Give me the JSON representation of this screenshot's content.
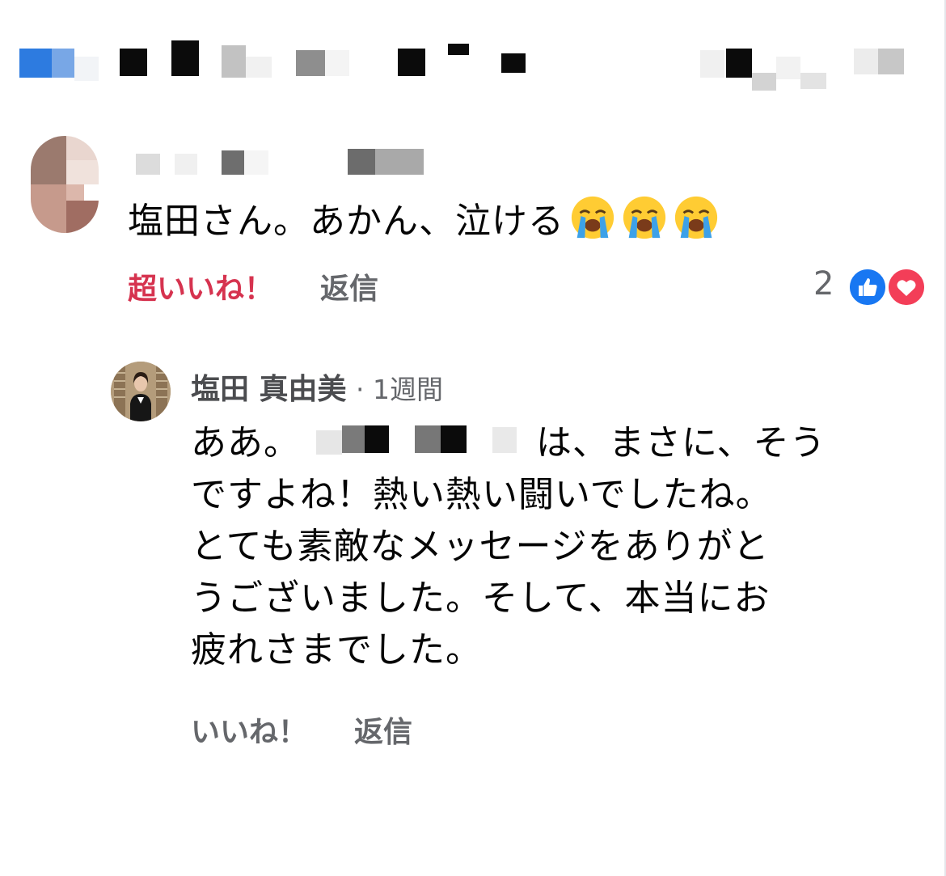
{
  "comment": {
    "text": "塩田さん。あかん、泣ける",
    "emojis": [
      "loudly-crying-face-icon",
      "loudly-crying-face-icon",
      "loudly-crying-face-icon"
    ],
    "actions": {
      "super_like": "超いいね！",
      "reply": "返信"
    },
    "reaction_count": "2",
    "reactions": [
      "like-icon",
      "love-icon"
    ]
  },
  "reply": {
    "author": "塩田 真由美",
    "time": "· 1週間",
    "lines": [
      {
        "prefix": "ああ。",
        "suffix": "は、まさに、そう"
      },
      "ですよね！熱い熱い闘いでしたね。",
      "とても素敵なメッセージをありがと",
      "うございました。そして、本当にお",
      "疲れさまでした。"
    ],
    "actions": {
      "like": "いいね！",
      "reply": "返信"
    }
  },
  "colors": {
    "super_like": "#d6334f",
    "secondary_text": "#65676b",
    "like_blue": "#1877f2",
    "love_red": "#f33e58"
  }
}
